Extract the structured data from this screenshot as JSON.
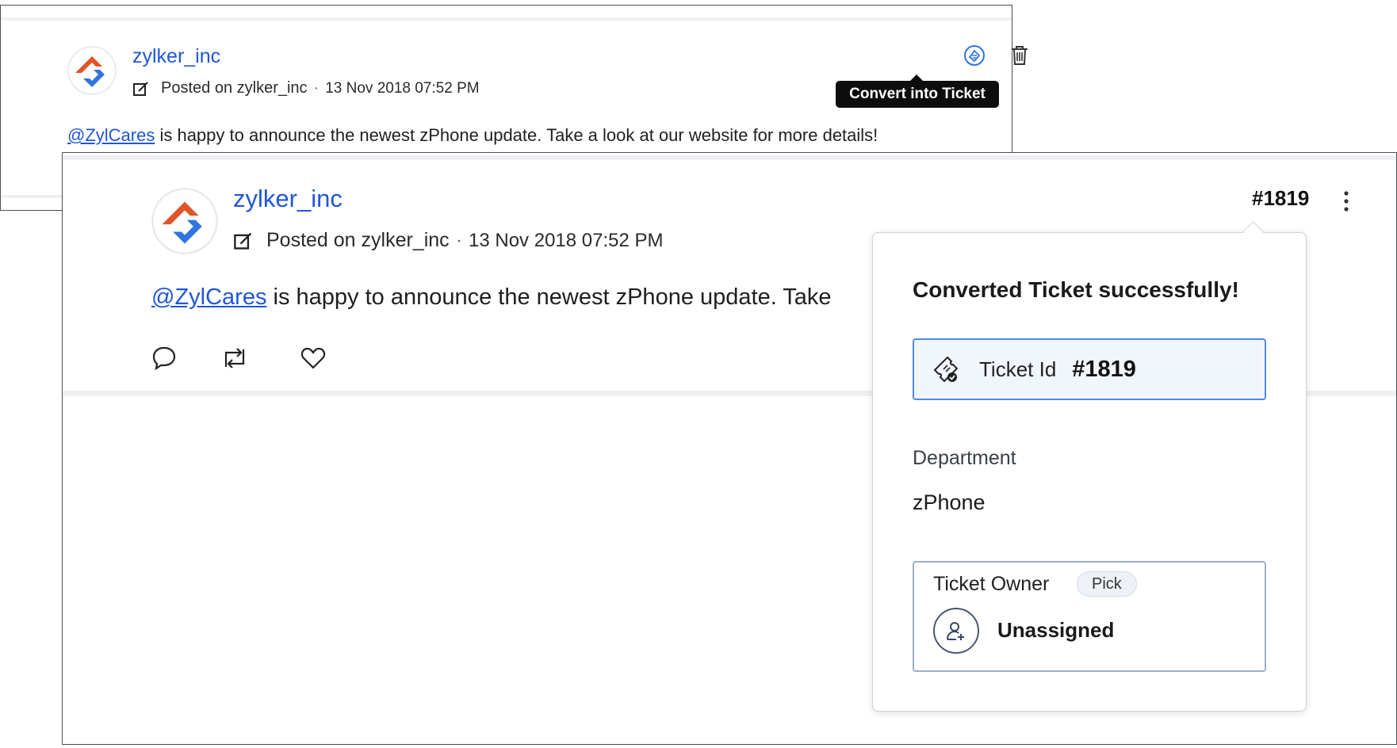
{
  "back_post": {
    "username": "zylker_inc",
    "posted_on_label": "Posted on zylker_inc",
    "timestamp": "13 Nov 2018 07:52 PM",
    "mention": "@ZylCares",
    "text": " is happy to announce the newest zPhone update. Take a look at our website for more details!",
    "tooltip": "Convert into Ticket",
    "icons": {
      "convert": "convert-ticket-icon",
      "delete": "trash-icon"
    }
  },
  "front_post": {
    "username": "zylker_inc",
    "posted_on_label": "Posted on zylker_inc",
    "timestamp": "13 Nov 2018 07:52 PM",
    "mention": "@ZylCares",
    "text": " is happy to announce the newest zPhone update. Take",
    "ticket_number": "#1819",
    "actions": [
      "reply-icon",
      "retweet-icon",
      "heart-icon"
    ]
  },
  "popover": {
    "title": "Converted Ticket successfully!",
    "ticket_id_label": "Ticket Id",
    "ticket_id_value": "#1819",
    "department_label": "Department",
    "department_value": "zPhone",
    "owner_label": "Ticket Owner",
    "pick_label": "Pick",
    "owner_value": "Unassigned"
  },
  "colors": {
    "link_blue": "#1f56d6",
    "logo_orange": "#e0552a",
    "logo_blue": "#2f74e0",
    "ticket_box_border": "#4d8de0",
    "tooltip_bg": "#0d0d0d"
  }
}
